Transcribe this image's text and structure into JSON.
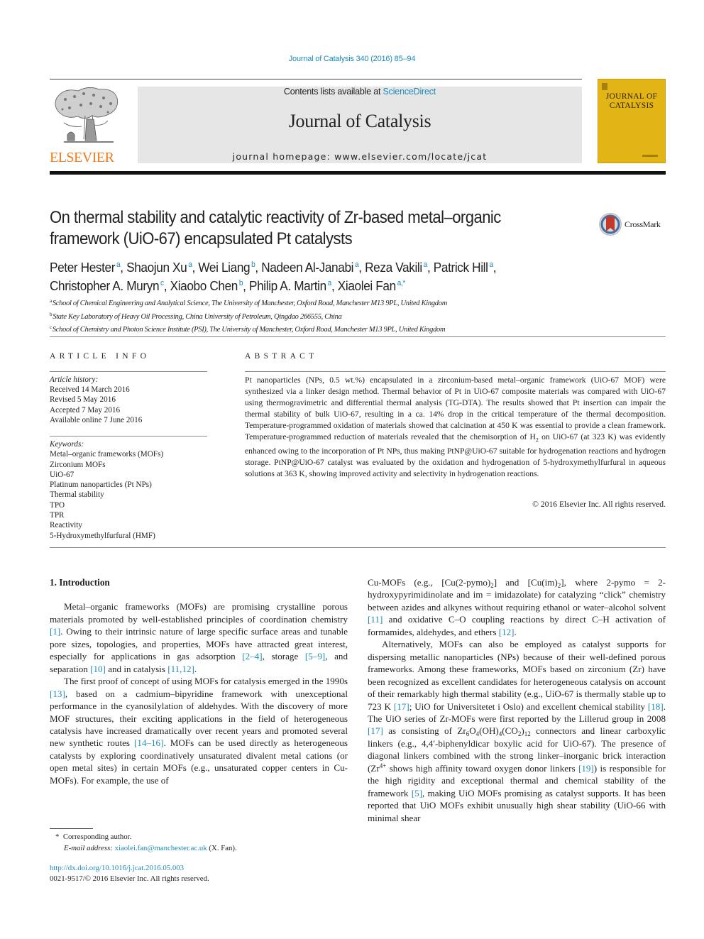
{
  "running_head": "Journal of Catalysis 340 (2016) 85–94",
  "masthead": {
    "contents_prefix": "Contents lists available at ",
    "contents_link": "ScienceDirect",
    "journal_name": "Journal of Catalysis",
    "homepage_prefix": "journal homepage: ",
    "homepage_url": "www.elsevier.com/locate/jcat",
    "publisher_logo_text": "ELSEVIER",
    "cover_title_line1": "JOURNAL OF",
    "cover_title_line2": "CATALYSIS"
  },
  "colors": {
    "link": "#1e8bb8",
    "elsevier_orange": "#f07a1a",
    "cover_yellow": "#e3b416",
    "masthead_gray": "#e6e6e6"
  },
  "article": {
    "title_line1": "On thermal stability and catalytic reactivity of Zr-based metal–organic",
    "title_line2": "framework (UiO-67) encapsulated Pt catalysts",
    "crossmark_label": "CrossMark",
    "authors": [
      {
        "name": "Peter Hester",
        "aff": "a",
        "sep": ", "
      },
      {
        "name": "Shaojun Xu",
        "aff": "a",
        "sep": ", "
      },
      {
        "name": "Wei Liang",
        "aff": "b",
        "sep": ", "
      },
      {
        "name": "Nadeen Al-Janabi",
        "aff": "a",
        "sep": ", "
      },
      {
        "name": "Reza Vakili",
        "aff": "a",
        "sep": ", "
      },
      {
        "name": "Patrick Hill",
        "aff": "a",
        "sep": ","
      },
      {
        "name": "Christopher A. Muryn",
        "aff": "c",
        "sep": ", "
      },
      {
        "name": "Xiaobo Chen",
        "aff": "b",
        "sep": ", "
      },
      {
        "name": "Philip A. Martin",
        "aff": "a",
        "sep": ", "
      },
      {
        "name": "Xiaolei Fan",
        "aff": "a,*",
        "sep": ""
      }
    ],
    "affiliations": [
      {
        "key": "a",
        "text": "School of Chemical Engineering and Analytical Science, The University of Manchester, Oxford Road, Manchester M13 9PL, United Kingdom"
      },
      {
        "key": "b",
        "text": "State Key Laboratory of Heavy Oil Processing, China University of Petroleum, Qingdao 266555, China"
      },
      {
        "key": "c",
        "text": "School of Chemistry and Photon Science Institute (PSI), The University of Manchester, Oxford Road, Manchester M13 9PL, United Kingdom"
      }
    ]
  },
  "article_info": {
    "heading": "ARTICLE INFO",
    "history_label": "Article history:",
    "history": [
      "Received 14 March 2016",
      "Revised 5 May 2016",
      "Accepted 7 May 2016",
      "Available online 7 June 2016"
    ],
    "keywords_label": "Keywords:",
    "keywords": [
      "Metal–organic frameworks (MOFs)",
      "Zirconium MOFs",
      "UiO-67",
      "Platinum nanoparticles (Pt NPs)",
      "Thermal stability",
      "TPO",
      "TPR",
      "Reactivity",
      "5-Hydroxymethylfurfural (HMF)"
    ]
  },
  "abstract": {
    "heading": "ABSTRACT",
    "part1": "Pt nanoparticles (NPs, 0.5 wt.%) encapsulated in a zirconium-based metal–organic framework (UiO-67 MOF) were synthesized via a linker design method. Thermal behavior of Pt in UiO-67 composite materials was compared with UiO-67 using thermogravimetric and differential thermal analysis (TG-DTA). The results showed that Pt insertion can impair the thermal stability of bulk UiO-67, resulting in a ca. 14% drop in the critical temperature of the thermal decomposition. Temperature-programmed oxidation of materials showed that calcination at 450 K was essential to provide a clean framework. Temperature-programmed reduction of materials revealed that the chemisorption of H",
    "sub1": "2",
    "part2": " on UiO-67 (at 323 K) was evidently enhanced owing to the incorporation of Pt NPs, thus making PtNP@UiO-67 suitable for hydro­genation reactions and hydrogen storage. PtNP@UiO-67 catalyst was evaluated by the oxidation and hydrogenation of 5-hydroxymethylfurfural in aqueous solutions at 363 K, showing improved activity and selectivity in hydrogenation reactions.",
    "copyright": "© 2016 Elsevier Inc. All rights reserved."
  },
  "body": {
    "section_heading": "1. Introduction",
    "left": {
      "p1": [
        {
          "t": "Metal–organic frameworks (MOFs) are promising crystalline porous materials promoted by well-established principles of coor­dination chemistry "
        },
        {
          "c": "[1]"
        },
        {
          "t": ". Owing to their intrinsic nature of large specific surface areas and tunable pore sizes, topologies, and prop­erties, MOFs have attracted great interest, especially for applica­tions in gas adsorption "
        },
        {
          "c": "[2–4]"
        },
        {
          "t": ", storage "
        },
        {
          "c": "[5–9]"
        },
        {
          "t": ", and separation "
        },
        {
          "c": "[10]"
        },
        {
          "t": " and in catalysis "
        },
        {
          "c": "[11,12]"
        },
        {
          "t": "."
        }
      ],
      "p2": [
        {
          "t": "The first proof of concept of using MOFs for catalysis emerged in the 1990s "
        },
        {
          "c": "[13]"
        },
        {
          "t": ", based on a cadmium–bipyridine framework with unexceptional performance in the cyanosilylation of aldehydes. With the discovery of more MOF structures, their exciting applica­tions in the field of heterogeneous catalysis have increased dramatically over recent years and promoted several new synthetic routes "
        },
        {
          "c": "[14–16]"
        },
        {
          "t": ". MOFs can be used directly as heteroge­neous catalysts by exploring coordinatively unsaturated divalent metal cations (or open metal sites) in certain MOFs (e.g., unsatu­rated copper centers in Cu-MOFs). For example, the use of"
        }
      ]
    },
    "right": {
      "p1": [
        {
          "t": "Cu-MOFs (e.g., [Cu(2-pymo)"
        },
        {
          "sub": "2"
        },
        {
          "t": "] and [Cu(im)"
        },
        {
          "sub": "2"
        },
        {
          "t": "], where 2-pymo = 2-hydroxypyrimidinolate and im = imidazolate) for catalyzing “click” chemistry between azides and alkynes without requiring ethanol or water–alcohol solvent "
        },
        {
          "c": "[11]"
        },
        {
          "t": " and oxidative C–O coupling reactions by direct C–H activation of formamides, aldehydes, and ethers "
        },
        {
          "c": "[12]"
        },
        {
          "t": "."
        }
      ],
      "p2": [
        {
          "t": "Alternatively, MOFs can also be employed as catalyst supports for dispersing metallic nanoparticles (NPs) because of their well-defined porous frameworks. Among these frameworks, MOFs based on zirconium (Zr) have been recognized as excellent candi­dates for heterogeneous catalysis on account of their remarkably high thermal stability (e.g., UiO-67 is thermally stable up to 723 K "
        },
        {
          "c": "[17]"
        },
        {
          "t": "; UiO for Universitetet i Oslo) and excellent chemical stability "
        },
        {
          "c": "[18]"
        },
        {
          "t": ". The UiO series of Zr-MOFs were first reported by the Lillerud group in 2008 "
        },
        {
          "c": "[17]"
        },
        {
          "t": " as consisting of Zr"
        },
        {
          "sub": "6"
        },
        {
          "t": "O"
        },
        {
          "sub": "4"
        },
        {
          "t": "(OH)"
        },
        {
          "sub": "4"
        },
        {
          "t": "(CO"
        },
        {
          "sub": "2"
        },
        {
          "t": ")"
        },
        {
          "sub": "12"
        },
        {
          "t": " connectors and linear carboxylic linkers (e.g., 4,4′-biphenyldicar boxylic acid for UiO-67). The presence of diagonal linkers com­bined with the strong linker–inorganic brick interaction (Zr"
        },
        {
          "sup": "4+"
        },
        {
          "t": " shows high affinity toward oxygen donor linkers "
        },
        {
          "c": "[19]"
        },
        {
          "t": ") is responsible for the high rigidity and exceptional thermal and chemical stability of the framework "
        },
        {
          "c": "[5]"
        },
        {
          "t": ", making UiO MOFs promis­ing as catalyst supports. It has been reported that UiO MOFs exhibit unusually high shear stability (UiO-66 with minimal shear"
        }
      ]
    }
  },
  "footnotes": {
    "star": "*",
    "corresponding": "Corresponding author.",
    "email_label": "E-mail address: ",
    "email": "xiaolei.fan@manchester.ac.uk",
    "email_suffix": " (X. Fan).",
    "doi": "http://dx.doi.org/10.1016/j.jcat.2016.05.003",
    "issn_line": "0021-9517/© 2016 Elsevier Inc. All rights reserved."
  }
}
